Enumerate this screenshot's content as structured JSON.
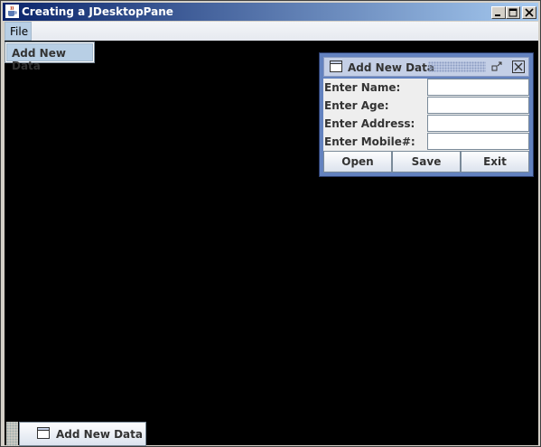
{
  "window": {
    "title": "Creating a JDesktopPane",
    "icons": [
      "java-cup-icon",
      "minimize-icon",
      "maximize-icon",
      "close-icon"
    ]
  },
  "menubar": {
    "file_label": "File"
  },
  "popup_menu": {
    "items": [
      {
        "label": "Add New Data"
      }
    ]
  },
  "internal_frame": {
    "title": "Add New Data",
    "fields": [
      {
        "label": "Enter Name:",
        "value": ""
      },
      {
        "label": "Enter Age:",
        "value": ""
      },
      {
        "label": "Enter Address:",
        "value": ""
      },
      {
        "label": "Enter Mobile#:",
        "value": ""
      }
    ],
    "buttons": [
      {
        "label": "Open"
      },
      {
        "label": "Save"
      },
      {
        "label": "Exit"
      }
    ]
  },
  "minimized_frame": {
    "label": "Add New Data"
  },
  "colors": {
    "desktop": "#000000",
    "frame_border": "#6382bf",
    "title_gradient_start": "#0a246a",
    "title_gradient_end": "#a6caf0",
    "menu_selected": "#b8cfe5"
  }
}
